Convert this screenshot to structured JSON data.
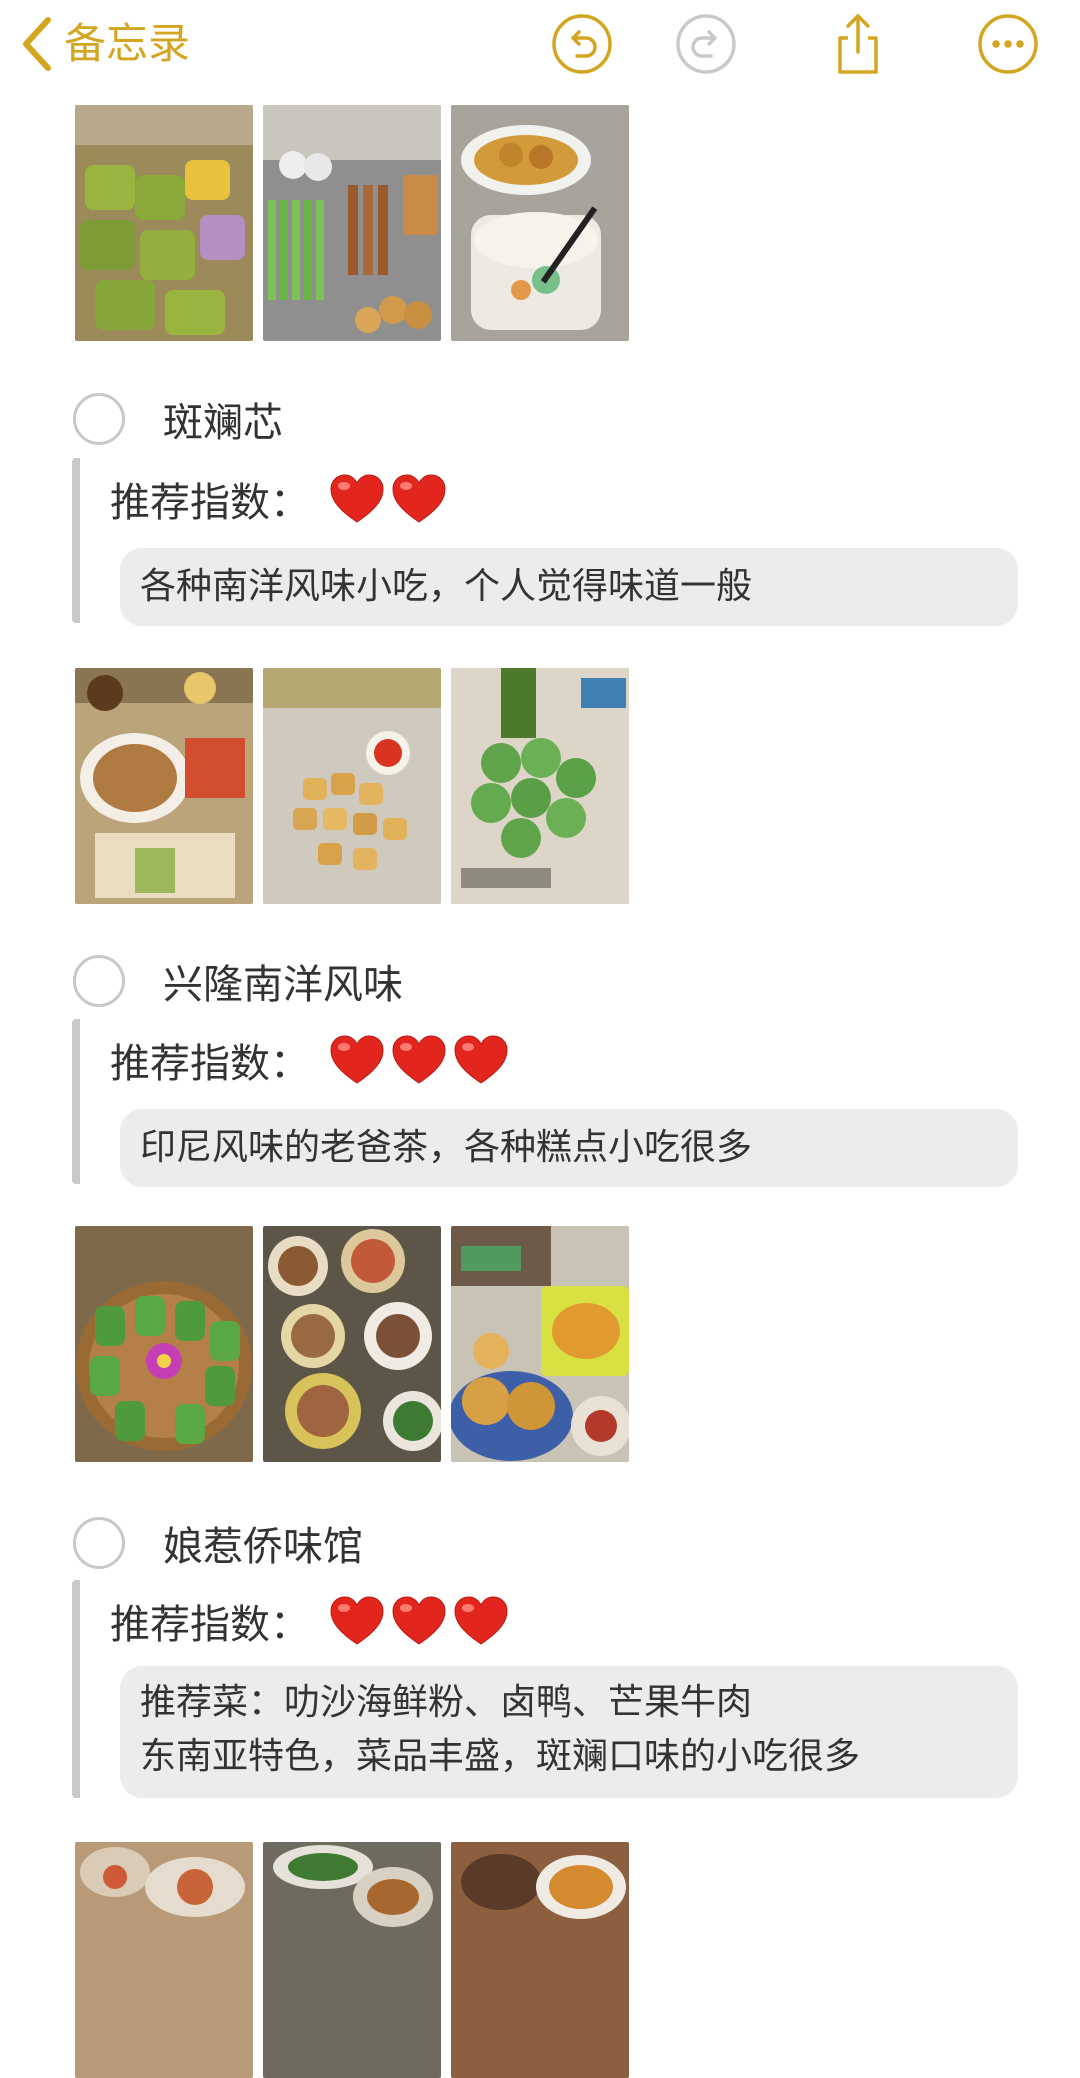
{
  "header": {
    "back_label": "备忘录",
    "icons": [
      "undo-icon",
      "redo-icon",
      "share-icon",
      "more-icon"
    ],
    "accent_color": "#d3a520"
  },
  "rating_label": "推荐指数：",
  "items": [
    {
      "title": "斑斓芯",
      "hearts": 2,
      "description": [
        "各种南洋风味小吃，个人觉得味道一般"
      ]
    },
    {
      "title": "兴隆南洋风味",
      "hearts": 3,
      "description": [
        "印尼风味的老爸茶，各种糕点小吃很多"
      ]
    },
    {
      "title": "娘惹侨味馆",
      "hearts": 3,
      "description": [
        "推荐菜：叻沙海鲜粉、卤鸭、芒果牛肉",
        "东南亚特色，菜品丰盛，斑斓口味的小吃很多"
      ]
    }
  ]
}
